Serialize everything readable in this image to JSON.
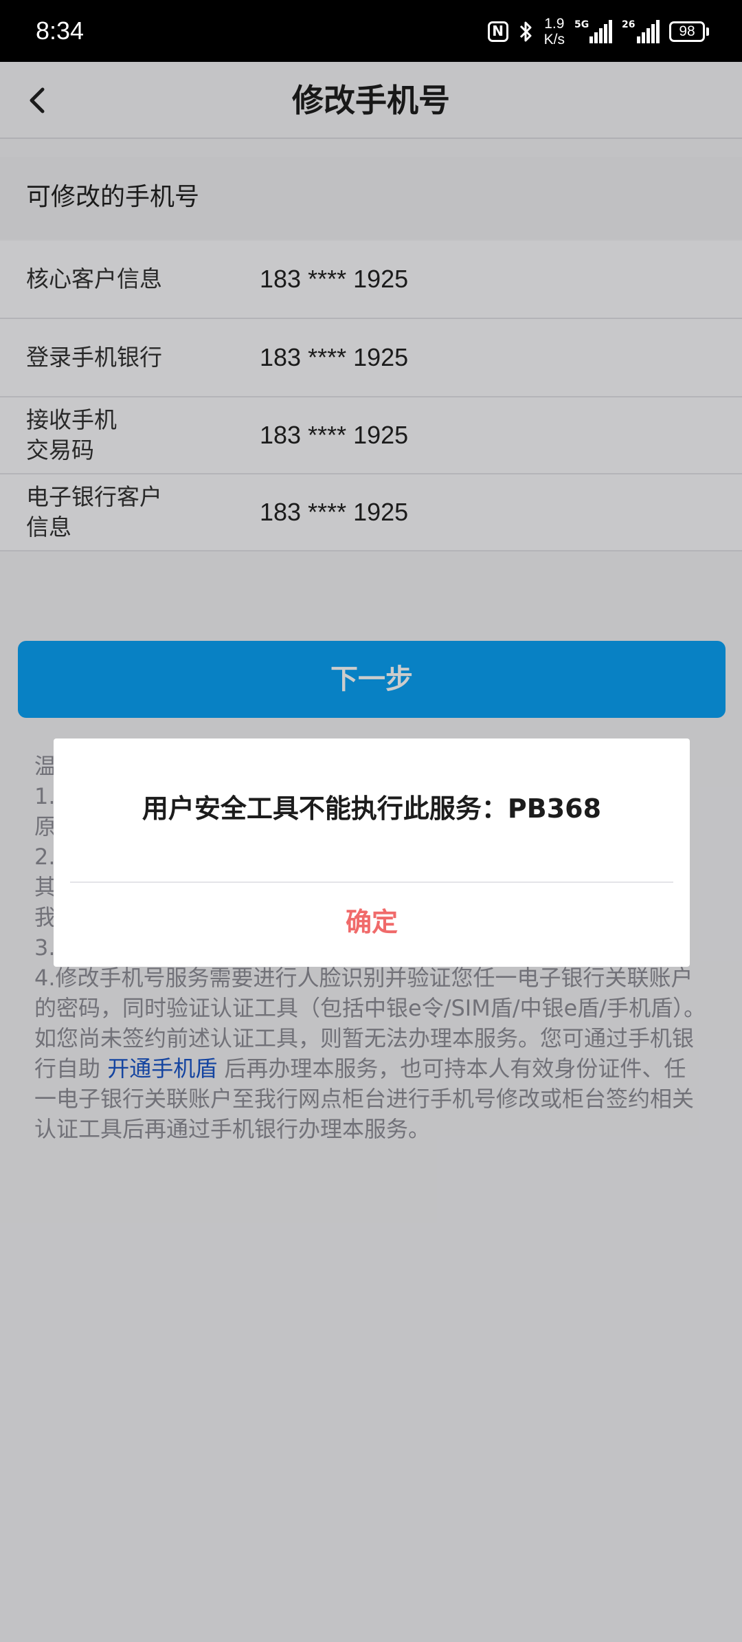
{
  "status_bar": {
    "time": "8:34",
    "speed_value": "1.9",
    "speed_unit": "K/s",
    "signal1_label": "5G",
    "signal2_label": "26",
    "battery": "98",
    "nfc_label": "N"
  },
  "header": {
    "title": "修改手机号"
  },
  "section": {
    "title": "可修改的手机号"
  },
  "rows": [
    {
      "label": "核心客户信息",
      "value": "183 **** 1925"
    },
    {
      "label": "登录手机银行",
      "value": "183 **** 1925"
    },
    {
      "label": "接收手机交易码",
      "value": "183 **** 1925"
    },
    {
      "label": "电子银行客户信息",
      "value": "183 **** 1925"
    }
  ],
  "next_button": {
    "label": "下一步"
  },
  "tips": {
    "heading": "温",
    "line1": "1.",
    "line1b": "原",
    "line2": "2.",
    "line2b": "其",
    "line2c": "我",
    "line3": "3.",
    "line4_part1": "4.修改手机号服务需要进行人脸识别并验证您任一电子银行关联账户的密码，同时验证认证工具（包括中银e令/SIM盾/中银e盾/手机盾）。如您尚未签约前述认证工具，则暂无法办理本服务。您可通过手机银行自助 ",
    "line4_link": "开通手机盾",
    "line4_part2": " 后再办理本服务，也可持本人有效身份证件、任一电子银行关联账户至我行网点柜台进行手机号修改或柜台签约相关认证工具后再通过手机银行办理本服务。"
  },
  "dialog": {
    "message": "用户安全工具不能执行此服务：PB368",
    "confirm_label": "确定"
  },
  "colors": {
    "primary": "#0aa2f5",
    "confirm": "#f06a6a",
    "link": "#1a55c8"
  }
}
